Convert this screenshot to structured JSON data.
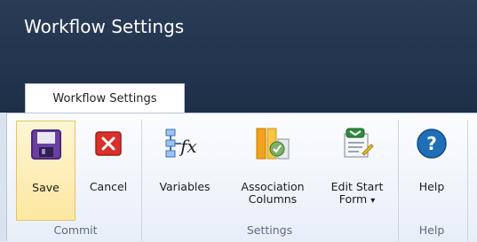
{
  "window": {
    "title": "Workflow Settings"
  },
  "tab": {
    "label": "Workflow Settings"
  },
  "ribbon": {
    "commit": {
      "group_label": "Commit",
      "save_label": "Save",
      "cancel_label": "Cancel"
    },
    "settings": {
      "group_label": "Settings",
      "variables_label": "Variables",
      "association_label_1": "Association",
      "association_label_2": "Columns",
      "edit_start_label_1": "Edit Start",
      "edit_start_label_2": "Form",
      "dropdown_glyph": "▾"
    },
    "help": {
      "group_label": "Help",
      "help_label": "Help",
      "help_glyph": "?"
    }
  },
  "icons": {
    "save": "save-icon",
    "cancel": "cancel-icon",
    "variables": "variables-icon",
    "association": "association-columns-icon",
    "edit_start": "edit-start-form-icon",
    "help": "help-icon"
  },
  "colors": {
    "title_bar": "#22344e",
    "ribbon": "#eef3fa",
    "active_button": "#fde7a1",
    "cancel_red": "#d9302b",
    "help_blue": "#1f6fb7",
    "accent_green": "#2e8b3d"
  }
}
